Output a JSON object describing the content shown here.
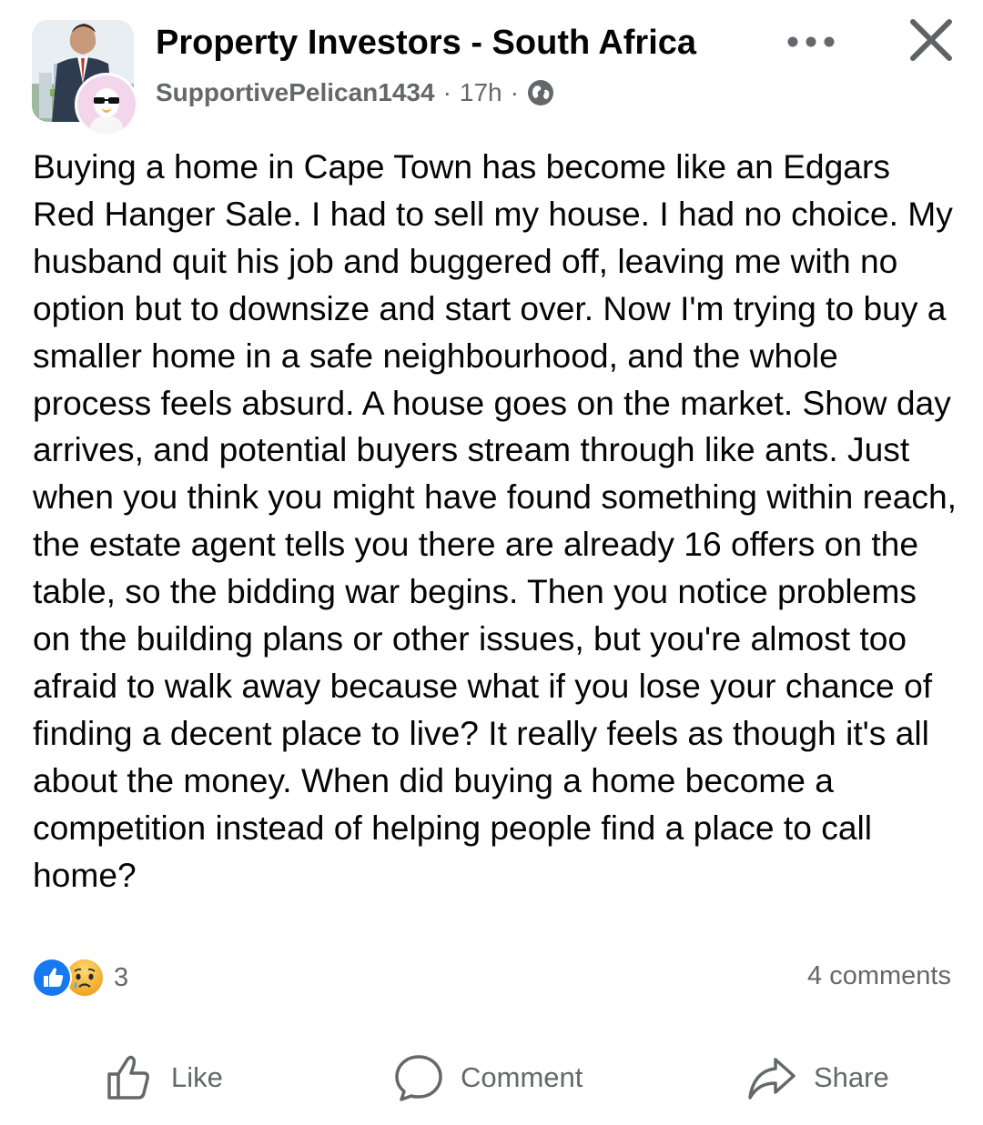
{
  "header": {
    "group_name": "Property Investors - South Africa",
    "author": "SupportivePelican1434",
    "separator": "·",
    "time": "17h"
  },
  "post": {
    "text": "Buying a home in Cape Town has become like an Edgars Red Hanger Sale. I had to sell my house. I had no choice. My husband quit his job and buggered off, leaving me with no option but to downsize and start over. Now I'm trying to buy a smaller home in a safe neighbourhood, and the whole process feels absurd. A house goes on the market. Show day arrives, and potential buyers stream through like ants. Just when you think you might have found something within reach, the estate agent tells you there are already 16 offers on the table, so the bidding war begins. Then you notice problems on the building plans or other issues, but you're almost too afraid to walk away because what if you lose your chance of finding a decent place to live? It really feels as though it's all about the money. When did buying a home become a competition instead of helping people find a place to call home?"
  },
  "stats": {
    "reaction_count": "3",
    "comments": "4 comments"
  },
  "actions": {
    "like": "Like",
    "comment": "Comment",
    "share": "Share"
  },
  "icons": {
    "more": "more-options-icon",
    "close": "close-icon",
    "privacy": "globe-icon",
    "reaction_like": "like-reaction-icon",
    "reaction_sad": "sad-reaction-icon",
    "like": "thumbs-up-icon",
    "comment": "comment-bubble-icon",
    "share": "share-arrow-icon"
  },
  "colors": {
    "primary_text": "#050505",
    "secondary_text": "#65676b",
    "like_blue": "#1877f2",
    "sad_yellow": "#f7b125"
  }
}
